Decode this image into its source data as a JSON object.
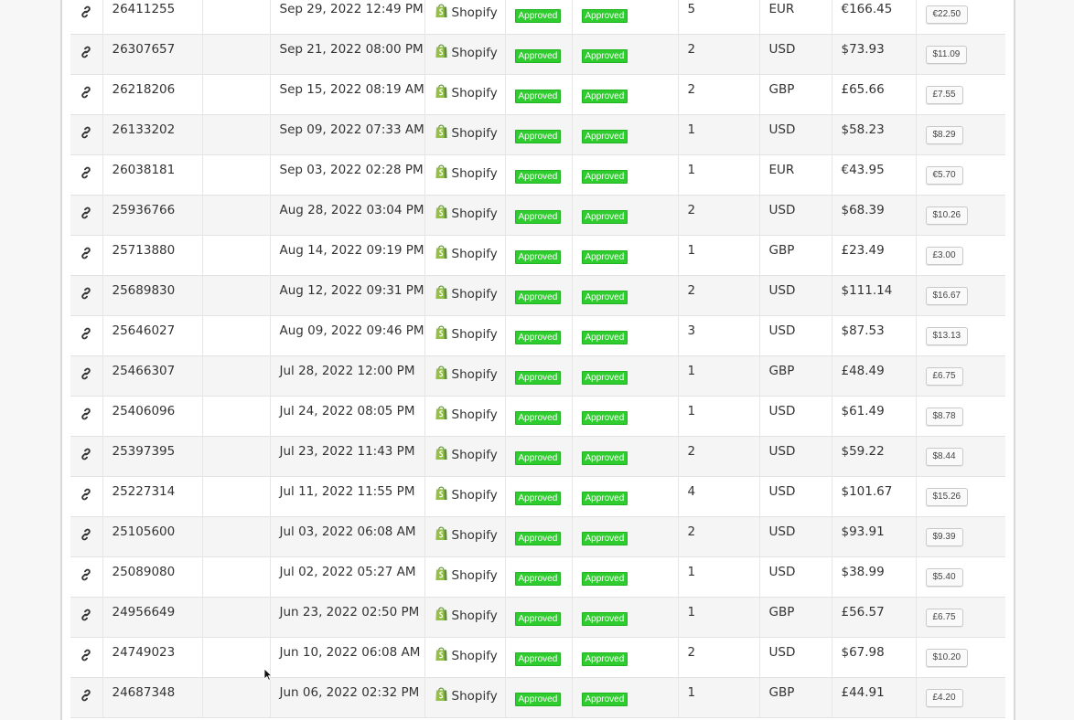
{
  "platform_label": "Shopify",
  "status_labels": {
    "first": "Approved",
    "second": "Approved"
  },
  "colors": {
    "approved_badge": "#2ecc2e",
    "shopify_green": "#95bf47"
  },
  "icons": {
    "row_link": "link-icon",
    "platform": "shopify-bag-icon",
    "pointer": "mouse-cursor"
  },
  "orders": [
    {
      "id": "26411255",
      "date": "Sep 29, 2022 12:49 PM",
      "items": "5",
      "currency": "EUR",
      "total": "€166.45",
      "fee": "€22.50"
    },
    {
      "id": "26307657",
      "date": "Sep 21, 2022 08:00 PM",
      "items": "2",
      "currency": "USD",
      "total": "$73.93",
      "fee": "$11.09"
    },
    {
      "id": "26218206",
      "date": "Sep 15, 2022 08:19 AM",
      "items": "2",
      "currency": "GBP",
      "total": "£65.66",
      "fee": "£7.55"
    },
    {
      "id": "26133202",
      "date": "Sep 09, 2022 07:33 AM",
      "items": "1",
      "currency": "USD",
      "total": "$58.23",
      "fee": "$8.29"
    },
    {
      "id": "26038181",
      "date": "Sep 03, 2022 02:28 PM",
      "items": "1",
      "currency": "EUR",
      "total": "€43.95",
      "fee": "€5.70"
    },
    {
      "id": "25936766",
      "date": "Aug 28, 2022 03:04 PM",
      "items": "2",
      "currency": "USD",
      "total": "$68.39",
      "fee": "$10.26"
    },
    {
      "id": "25713880",
      "date": "Aug 14, 2022 09:19 PM",
      "items": "1",
      "currency": "GBP",
      "total": "£23.49",
      "fee": "£3.00"
    },
    {
      "id": "25689830",
      "date": "Aug 12, 2022 09:31 PM",
      "items": "2",
      "currency": "USD",
      "total": "$111.14",
      "fee": "$16.67"
    },
    {
      "id": "25646027",
      "date": "Aug 09, 2022 09:46 PM",
      "items": "3",
      "currency": "USD",
      "total": "$87.53",
      "fee": "$13.13"
    },
    {
      "id": "25466307",
      "date": "Jul 28, 2022 12:00 PM",
      "items": "1",
      "currency": "GBP",
      "total": "£48.49",
      "fee": "£6.75"
    },
    {
      "id": "25406096",
      "date": "Jul 24, 2022 08:05 PM",
      "items": "1",
      "currency": "USD",
      "total": "$61.49",
      "fee": "$8.78"
    },
    {
      "id": "25397395",
      "date": "Jul 23, 2022 11:43 PM",
      "items": "2",
      "currency": "USD",
      "total": "$59.22",
      "fee": "$8.44"
    },
    {
      "id": "25227314",
      "date": "Jul 11, 2022 11:55 PM",
      "items": "4",
      "currency": "USD",
      "total": "$101.67",
      "fee": "$15.26"
    },
    {
      "id": "25105600",
      "date": "Jul 03, 2022 06:08 AM",
      "items": "2",
      "currency": "USD",
      "total": "$93.91",
      "fee": "$9.39"
    },
    {
      "id": "25089080",
      "date": "Jul 02, 2022 05:27 AM",
      "items": "1",
      "currency": "USD",
      "total": "$38.99",
      "fee": "$5.40"
    },
    {
      "id": "24956649",
      "date": "Jun 23, 2022 02:50 PM",
      "items": "1",
      "currency": "GBP",
      "total": "£56.57",
      "fee": "£6.75"
    },
    {
      "id": "24749023",
      "date": "Jun 10, 2022 06:08 AM",
      "items": "2",
      "currency": "USD",
      "total": "$67.98",
      "fee": "$10.20"
    },
    {
      "id": "24687348",
      "date": "Jun 06, 2022 02:32 PM",
      "items": "1",
      "currency": "GBP",
      "total": "£44.91",
      "fee": "£4.20"
    }
  ]
}
